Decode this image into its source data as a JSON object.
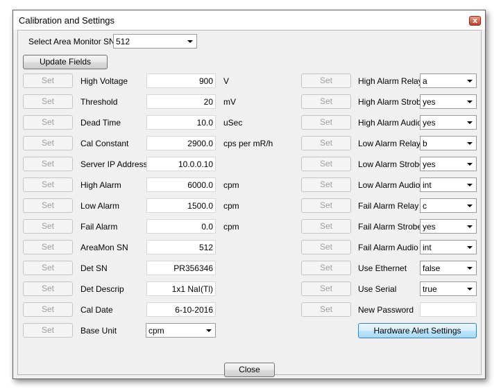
{
  "window": {
    "title": "Calibration and Settings",
    "close_glyph": "x"
  },
  "monitor": {
    "label": "Select Area Monitor SN",
    "value": "512"
  },
  "update_button": "Update Fields",
  "set_label": "Set",
  "left_rows": [
    {
      "label": "High Voltage",
      "value": "900",
      "unit": "V"
    },
    {
      "label": "Threshold",
      "value": "20",
      "unit": "mV"
    },
    {
      "label": "Dead Time",
      "value": "10.0",
      "unit": "uSec"
    },
    {
      "label": "Cal Constant",
      "value": "2900.0",
      "unit": "cps per mR/h"
    },
    {
      "label": "Server IP Address",
      "value": "10.0.0.10",
      "unit": ""
    },
    {
      "label": "High Alarm",
      "value": "6000.0",
      "unit": "cpm"
    },
    {
      "label": "Low Alarm",
      "value": "1500.0",
      "unit": "cpm"
    },
    {
      "label": "Fail Alarm",
      "value": "0.0",
      "unit": "cpm"
    },
    {
      "label": "AreaMon SN",
      "value": "512",
      "unit": ""
    },
    {
      "label": "Det SN",
      "value": "PR356346",
      "unit": ""
    },
    {
      "label": "Det Descrip",
      "value": "1x1 NaI(Tl)",
      "unit": ""
    },
    {
      "label": "Cal Date",
      "value": "6-10-2016",
      "unit": ""
    }
  ],
  "base_unit": {
    "label": "Base Unit",
    "value": "cpm"
  },
  "right_rows": [
    {
      "label": "High Alarm Relay",
      "value": "a"
    },
    {
      "label": "High Alarm Strobe",
      "value": "yes"
    },
    {
      "label": "High Alarm Audio",
      "value": "yes"
    },
    {
      "label": "Low Alarm Relay",
      "value": "b"
    },
    {
      "label": "Low Alarm Strobe",
      "value": "yes"
    },
    {
      "label": "Low Alarm Audio",
      "value": "int"
    },
    {
      "label": "Fail Alarm Relay",
      "value": "c"
    },
    {
      "label": "Fail Alarm Strobe",
      "value": "yes"
    },
    {
      "label": "Fail Alarm Audio",
      "value": "int"
    },
    {
      "label": "Use Ethernet",
      "value": "false"
    },
    {
      "label": "Use Serial",
      "value": "true"
    }
  ],
  "new_password": {
    "label": "New Password",
    "value": ""
  },
  "hardware_button": "Hardware Alert Settings",
  "close_button": "Close"
}
